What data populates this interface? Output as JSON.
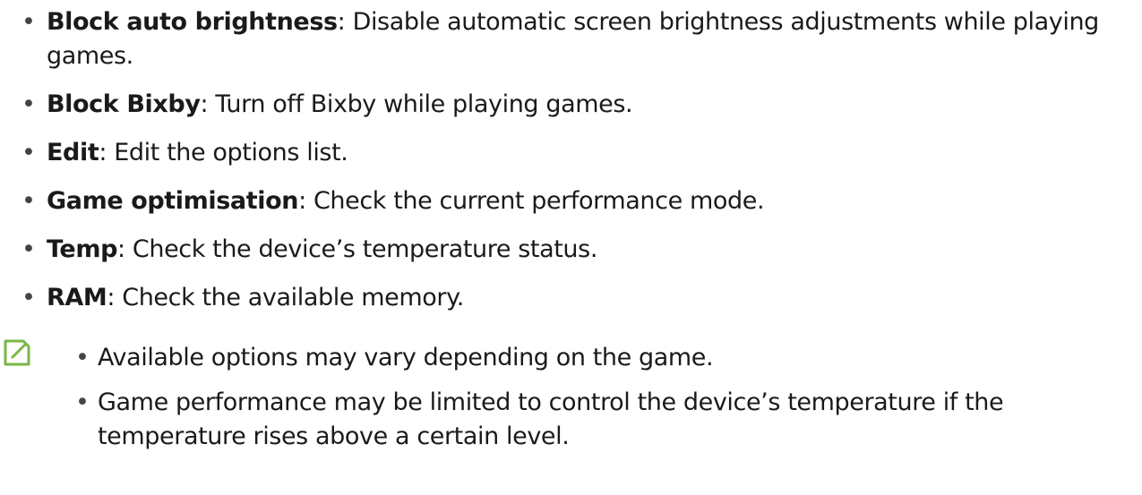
{
  "bullets": [
    {
      "term": "Block auto brightness",
      "sep": ": ",
      "desc": "Disable automatic screen brightness adjustments while playing games."
    },
    {
      "term": "Block Bixby",
      "sep": ": ",
      "desc": "Turn off Bixby while playing games."
    },
    {
      "term": "Edit",
      "sep": ": ",
      "desc": "Edit the options list."
    },
    {
      "term": "Game optimisation",
      "sep": ": ",
      "desc": "Check the current performance mode."
    },
    {
      "term": "Temp",
      "sep": ": ",
      "desc": "Check the device’s temperature status."
    },
    {
      "term": "RAM",
      "sep": ": ",
      "desc": "Check the available memory."
    }
  ],
  "bullet_glyph": "•",
  "note": {
    "icon": "note-pencil-icon",
    "icon_color": "#7ab648",
    "items": [
      "Available options may vary depending on the game.",
      "Game performance may be limited to control the device’s temperature if the temperature rises above a certain level."
    ]
  }
}
